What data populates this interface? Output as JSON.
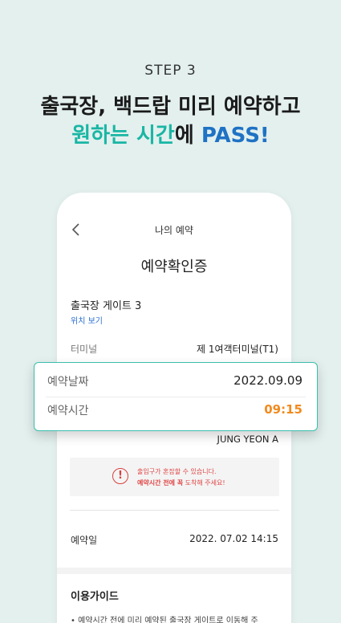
{
  "header": {
    "step": "STEP 3",
    "line1": "출국장, 백드랍 미리 예약하고",
    "line2_highlight": "원하는 시간",
    "line2_mid": "에 ",
    "line2_brand": "PASS!"
  },
  "nav": {
    "back_icon": "chevron-left-icon",
    "title": "나의 예약"
  },
  "ticket": {
    "title": "예약확인증",
    "gate": "출국장 게이트 3",
    "location_link": "위치 보기",
    "terminal_label": "터미널",
    "terminal_value": "제 1여객터미널(T1)",
    "passenger_name": "JUNG YEON A",
    "booking_date_label": "예약일",
    "booking_date_value": "2022. 07.02 14:15"
  },
  "notice": {
    "icon": "alert-circle-icon",
    "line1": "출입구가 혼잡할 수 있습니다.",
    "line2_bold": "예약시간 전에 꼭",
    "line2_rest": " 도착해 주세요!"
  },
  "guide": {
    "title": "이용가이드",
    "item1": "•  예약시간 전에 미리 예약된 출국장 게이트로 이동해 주"
  },
  "highlight": {
    "date_label": "예약날짜",
    "date_value": "2022.09.09",
    "time_label": "예약시간",
    "time_value": "09:15"
  },
  "colors": {
    "background": "#e3f0ee",
    "accent_teal": "#19b6a4",
    "accent_blue": "#1f72c4",
    "time_orange": "#f28a1e",
    "alert_red": "#e04646"
  }
}
